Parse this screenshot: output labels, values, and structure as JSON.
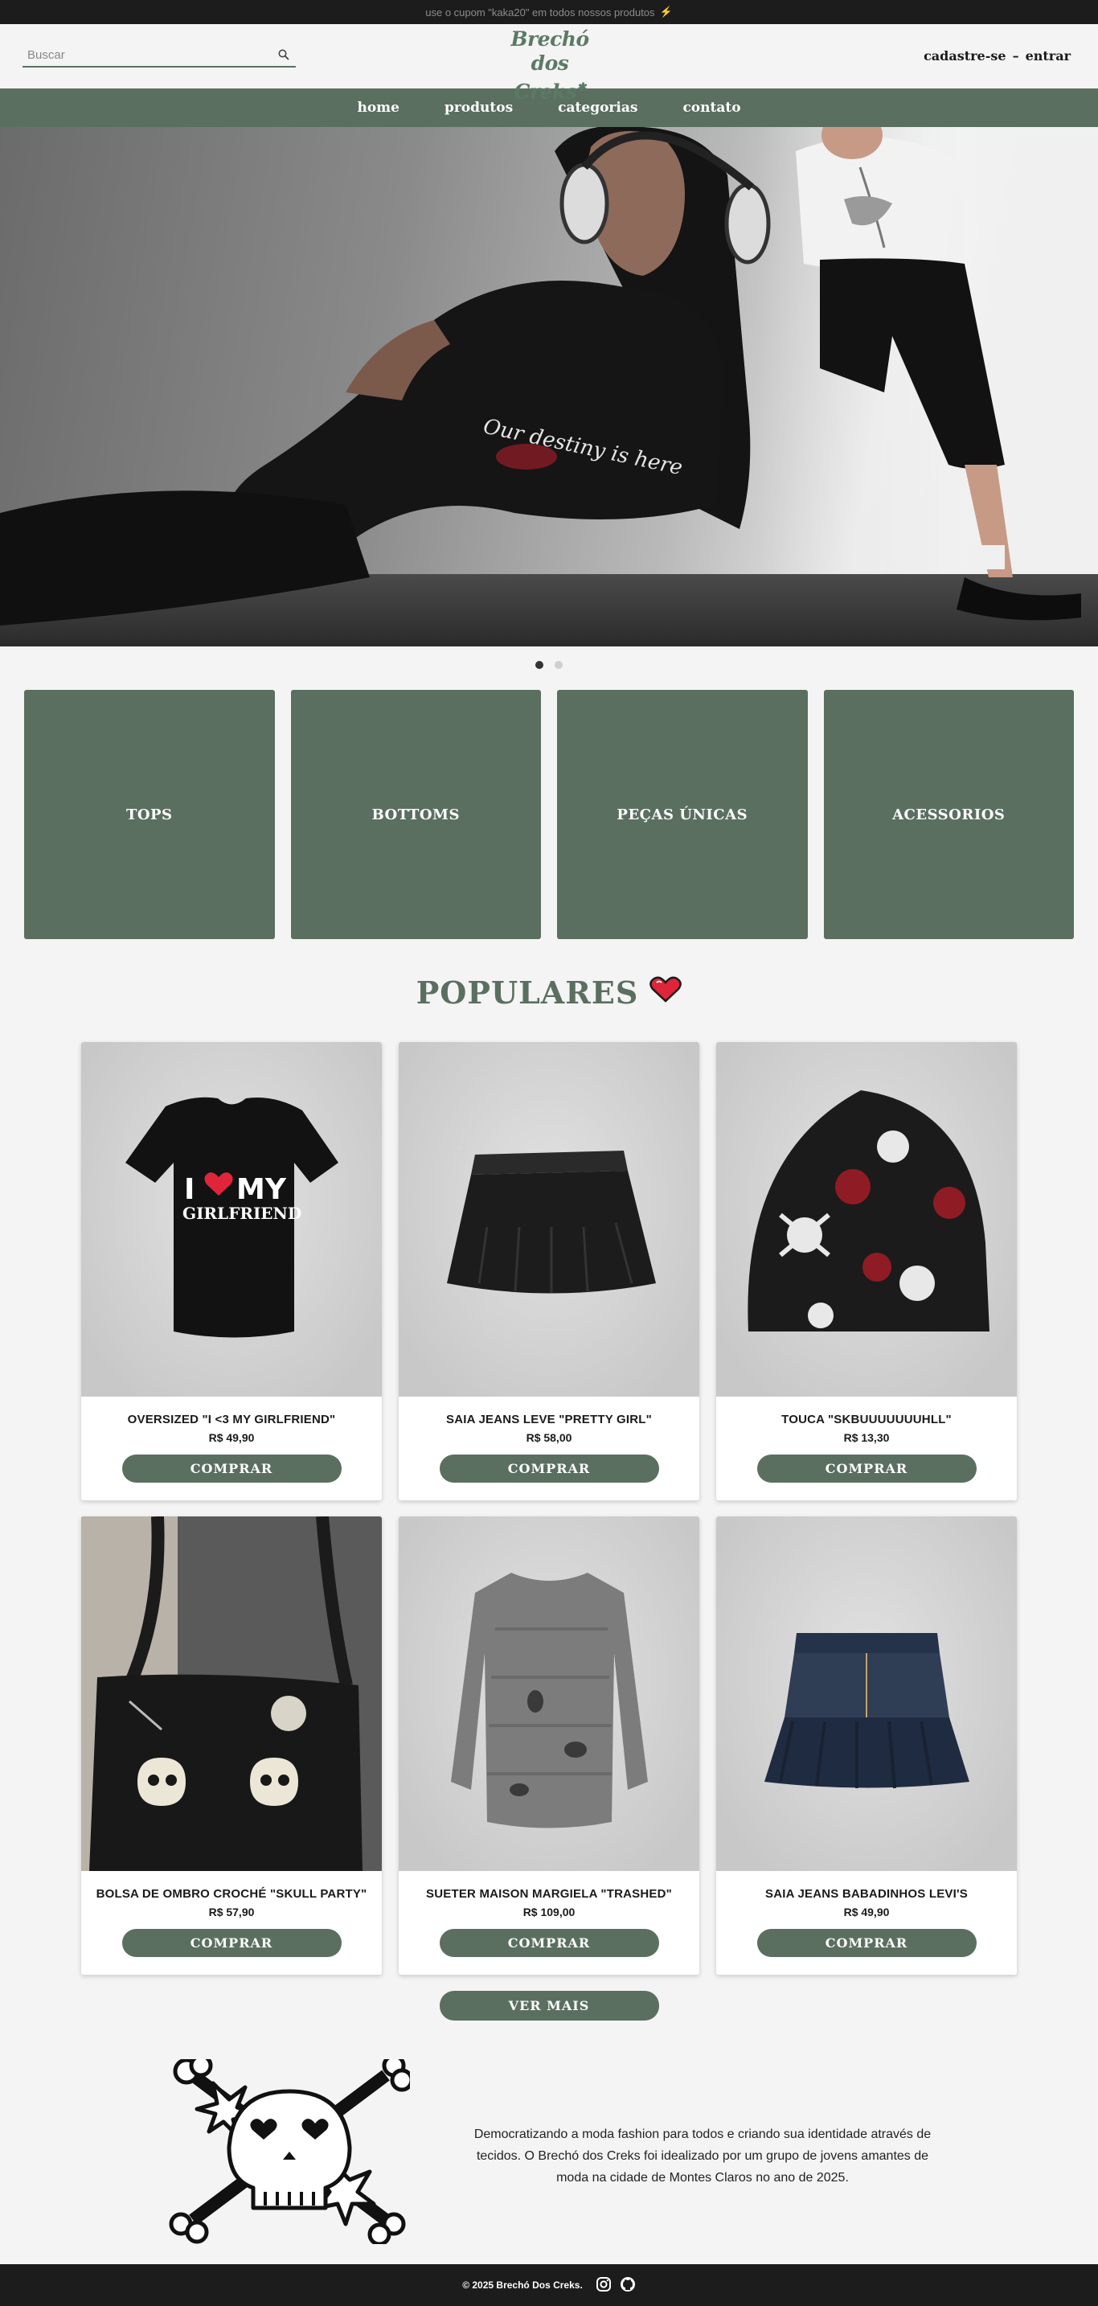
{
  "announcement": {
    "text": "use o cupom \"kaka20\" em todos nossos produtos",
    "icon": "lightning-icon"
  },
  "header": {
    "search_placeholder": "Buscar",
    "logo_line1": "Brechó",
    "logo_line2": "dos Creks",
    "signup": "cadastre-se",
    "separator": "–",
    "login": "entrar"
  },
  "nav": {
    "home": "home",
    "produtos": "produtos",
    "categorias": "categorias",
    "contato": "contato"
  },
  "carousel": {
    "slides": 2,
    "active": 0
  },
  "categories": [
    {
      "label": "TOPS"
    },
    {
      "label": "BOTTOMS"
    },
    {
      "label": "PEÇAS ÚNICAS"
    },
    {
      "label": "ACESSORIOS"
    }
  ],
  "populares": {
    "title": "POPULARES",
    "icon": "heart-icon"
  },
  "products": [
    {
      "name": "OVERSIZED \"I <3 MY GIRLFRIEND\"",
      "price": "R$ 49,90",
      "button": "COMPRAR",
      "tee_line1": "I",
      "tee_line1b": "MY",
      "tee_line2": "GIRLFRIEND"
    },
    {
      "name": "SAIA JEANS LEVE \"PRETTY GIRL\"",
      "price": "R$ 58,00",
      "button": "COMPRAR"
    },
    {
      "name": "TOUCA \"SKBUUUUUUUHLL\"",
      "price": "R$ 13,30",
      "button": "COMPRAR"
    },
    {
      "name": "BOLSA DE OMBRO CROCHÉ \"SKULL PARTY\"",
      "price": "R$ 57,90",
      "button": "COMPRAR"
    },
    {
      "name": "SUETER MAISON MARGIELA \"TRASHED\"",
      "price": "R$ 109,00",
      "button": "COMPRAR"
    },
    {
      "name": "SAIA JEANS BABADINHOS LEVI'S",
      "price": "R$ 49,90",
      "button": "COMPRAR"
    }
  ],
  "ver_mais": "VER MAIS",
  "about": {
    "text": "Democratizando a moda fashion para todos e criando sua identidade através de tecidos. O Brechó dos Creks foi idealizado por um grupo de jovens amantes de moda na cidade de Montes Claros no ano de 2025."
  },
  "footer": {
    "copyright": "© 2025 Brechó Dos Creks.",
    "icons": [
      "instagram-icon",
      "github-icon"
    ]
  },
  "colors": {
    "brand_green": "#5b6f61",
    "dark_bar": "#1c1c1c",
    "background": "#f4f4f4"
  }
}
